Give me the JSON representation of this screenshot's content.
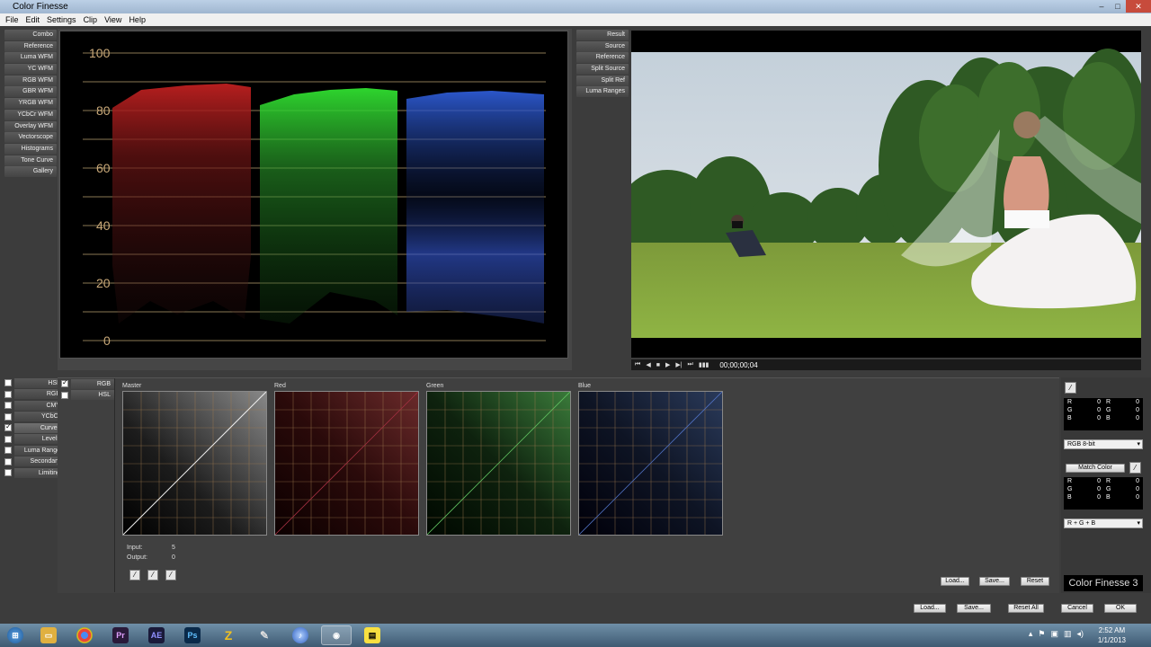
{
  "window": {
    "title": "Color Finesse"
  },
  "menu": [
    "File",
    "Edit",
    "Settings",
    "Clip",
    "View",
    "Help"
  ],
  "scope_tabs": [
    "Combo",
    "Reference",
    "Luma WFM",
    "YC WFM",
    "RGB WFM",
    "GBR WFM",
    "YRGB WFM",
    "YCbCr WFM",
    "Overlay WFM",
    "Vectorscope",
    "Histograms",
    "Tone Curve",
    "Gallery"
  ],
  "scope": {
    "y_labels": [
      "100",
      "80",
      "60",
      "40",
      "20",
      "0"
    ]
  },
  "viewer_tabs": [
    "Result",
    "Source",
    "Reference",
    "Split Source",
    "Split Ref",
    "Luma Ranges"
  ],
  "transport": {
    "timecode": "00;00;00;04"
  },
  "correction_tabs": [
    {
      "label": "HSL",
      "checked": false
    },
    {
      "label": "RGB",
      "checked": false
    },
    {
      "label": "CMY",
      "checked": false
    },
    {
      "label": "YCbCr",
      "checked": false
    },
    {
      "label": "Curves",
      "checked": true
    },
    {
      "label": "Levels",
      "checked": false
    },
    {
      "label": "Luma Range",
      "checked": false
    },
    {
      "label": "Secondary",
      "checked": false
    },
    {
      "label": "Limiting",
      "checked": false
    }
  ],
  "mode_tabs": [
    {
      "label": "RGB",
      "checked": true
    },
    {
      "label": "HSL",
      "checked": false
    }
  ],
  "curves": {
    "labels": [
      "Master",
      "Red",
      "Green",
      "Blue"
    ],
    "input_label": "Input:",
    "input_value": "5",
    "output_label": "Output:",
    "output_value": "0"
  },
  "panel_buttons": {
    "load": "Load...",
    "save": "Save...",
    "reset": "Reset"
  },
  "footer_buttons": {
    "load": "Load...",
    "save": "Save...",
    "reset_all": "Reset All",
    "cancel": "Cancel",
    "ok": "OK"
  },
  "right_panel": {
    "sample1": {
      "rows": [
        [
          "R",
          "0",
          "R",
          "0"
        ],
        [
          "G",
          "0",
          "G",
          "0"
        ],
        [
          "B",
          "0",
          "B",
          "0"
        ]
      ]
    },
    "bit_depth": "RGB 8-bit",
    "match_color": "Match Color",
    "sample2": {
      "rows": [
        [
          "R",
          "0",
          "R",
          "0"
        ],
        [
          "G",
          "0",
          "G",
          "0"
        ],
        [
          "B",
          "0",
          "B",
          "0"
        ]
      ]
    },
    "match_mode": "R + G + B",
    "brand": "Color Finesse 3"
  },
  "taskbar": {
    "time": "2:52 AM",
    "date": "1/1/2013",
    "apps": [
      "Pr",
      "AE",
      "Ps"
    ]
  }
}
